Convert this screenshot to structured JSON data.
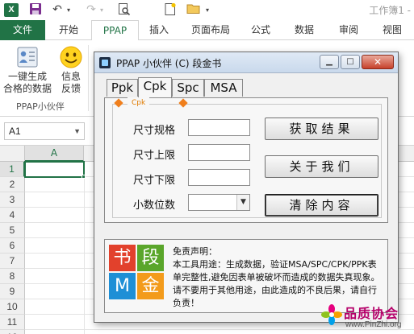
{
  "window": {
    "title": "工作簿1 -"
  },
  "quick_access": {
    "save_icon": "save-icon",
    "undo_icon": "undo-icon",
    "redo_icon": "redo-icon",
    "print_preview_icon": "print-preview-icon",
    "new_icon": "new-document-icon",
    "open_icon": "open-folder-icon"
  },
  "ribbon": {
    "tabs": [
      {
        "label": "文件"
      },
      {
        "label": "开始"
      },
      {
        "label": "PPAP"
      },
      {
        "label": "插入"
      },
      {
        "label": "页面布局"
      },
      {
        "label": "公式"
      },
      {
        "label": "数据"
      },
      {
        "label": "审阅"
      },
      {
        "label": "视图"
      }
    ],
    "active_tab": "PPAP",
    "buttons": [
      {
        "label": "一键生成合格的数据",
        "icon": "form-icon"
      },
      {
        "label": "信息反馈",
        "icon": "smiley-icon"
      }
    ],
    "button1_line1": "一键生成",
    "button1_line2": "合格的数据",
    "button2_line1": "信息",
    "button2_line2": "反馈",
    "group_label": "PPAP小伙伴"
  },
  "formula_bar": {
    "name_box": "A1"
  },
  "sheet": {
    "column_header": "A",
    "rows": [
      "1",
      "2",
      "3",
      "4",
      "5",
      "6",
      "7",
      "8",
      "9",
      "10",
      "11",
      "12"
    ],
    "active_cell": "A1"
  },
  "dialog": {
    "title": "PPAP 小伙伴 (C) 段金书",
    "tabs": [
      {
        "label": "Ppk"
      },
      {
        "label": "Cpk"
      },
      {
        "label": "Spc"
      },
      {
        "label": "MSA"
      }
    ],
    "active_tab": "Cpk",
    "group_label": "Cpk",
    "fields": [
      {
        "label": "尺寸规格",
        "value": ""
      },
      {
        "label": "尺寸上限",
        "value": ""
      },
      {
        "label": "尺寸下限",
        "value": ""
      }
    ],
    "decimal_label": "小数位数",
    "decimal_value": "",
    "buttons": {
      "get_result": "获取结果",
      "about": "关于我们",
      "clear": "清除内容"
    },
    "logo": [
      "书",
      "段",
      "M",
      "金"
    ],
    "disclaimer_title": "免责声明：",
    "disclaimer_body": "本工具用途：生成数据，验证MSA/SPC/CPK/PPK表单完整性,避免因表单被破坏而造成的数据失真现象。",
    "disclaimer_warning": "请不要用于其他用途，由此造成的不良后果，请自行负责！"
  },
  "watermark": {
    "name": "品质协会",
    "url": "www.PinZhi.org"
  },
  "colors": {
    "excel_green": "#217346",
    "accent_orange": "#f07f1c",
    "logo_red": "#e2412c",
    "logo_green": "#5aa62b",
    "logo_blue": "#1e8fd6",
    "logo_orange": "#f39b1b"
  }
}
